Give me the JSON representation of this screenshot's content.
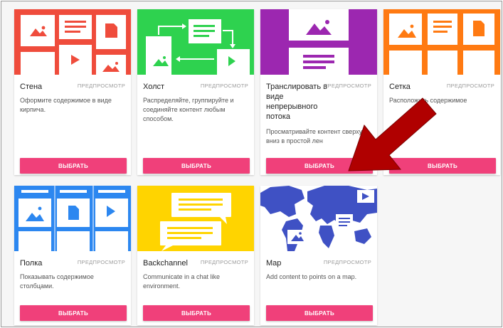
{
  "common": {
    "preview_label": "ПРЕДПРОСМОТР",
    "select_label": "ВЫБРАТЬ"
  },
  "colors": {
    "button": "#f0407a",
    "wall": "#ef4c3c",
    "canvas": "#2ed24f",
    "stream": "#9c27b0",
    "grid": "#ff7a12",
    "shelf": "#2c87f0",
    "backchannel": "#ffd400",
    "map": "#3f51c4",
    "arrow": "#b00000"
  },
  "cards": [
    {
      "key": "wall",
      "title": "Стена",
      "desc": "Оформите содержимое в виде кирпича.",
      "icon": "wall-layout-icon"
    },
    {
      "key": "canvas",
      "title": "Холст",
      "desc": "Распределяйте, группируйте и соединяйте контент любым способом.",
      "icon": "canvas-layout-icon"
    },
    {
      "key": "stream",
      "title": "Транслировать в виде непрерывного потока",
      "desc": "Просматривайте контент сверху вниз в простой лен",
      "icon": "stream-layout-icon"
    },
    {
      "key": "grid",
      "title": "Сетка",
      "desc": "Расположить содержимое",
      "icon": "grid-layout-icon"
    },
    {
      "key": "shelf",
      "title": "Полка",
      "desc": "Показывать содержимое столбцами.",
      "icon": "shelf-layout-icon"
    },
    {
      "key": "backchannel",
      "title": "Backchannel",
      "desc": "Communicate in a chat like environment.",
      "icon": "chat-layout-icon"
    },
    {
      "key": "map",
      "title": "Map",
      "desc": "Add content to points on a map.",
      "icon": "map-layout-icon"
    }
  ],
  "annotation": {
    "icon": "red-arrow-icon"
  }
}
